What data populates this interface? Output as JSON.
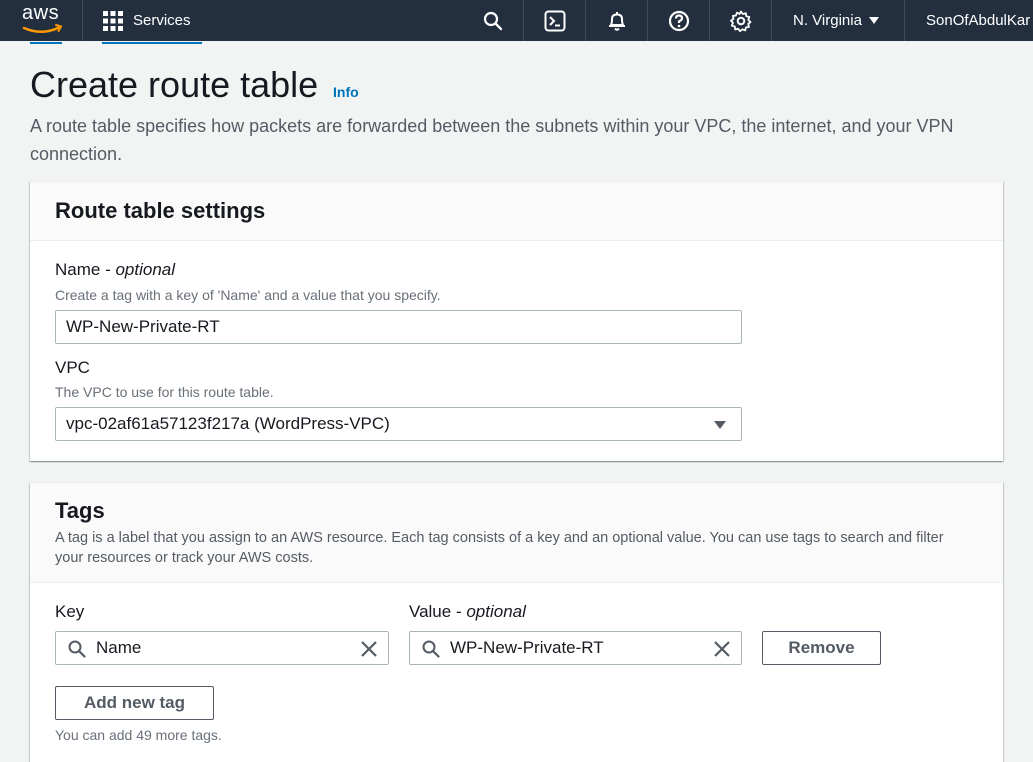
{
  "nav": {
    "logo": "aws",
    "services_label": "Services",
    "region": "N. Virginia",
    "account": "SonOfAbdulKar",
    "icons": [
      "grid-icon",
      "search-icon",
      "cloudshell-icon",
      "bell-icon",
      "help-icon",
      "gear-icon",
      "caret-down-icon"
    ]
  },
  "header": {
    "title": "Create route table",
    "info": "Info",
    "description": "A route table specifies how packets are forwarded between the subnets within your VPC, the internet, and your VPN connection."
  },
  "settings": {
    "title": "Route table settings",
    "name_label": "Name - ",
    "name_optional": "optional",
    "name_desc": "Create a tag with a key of 'Name' and a value that you specify.",
    "name_value": "WP-New-Private-RT",
    "vpc_label": "VPC",
    "vpc_desc": "The VPC to use for this route table.",
    "vpc_value": "vpc-02af61a57123f217a (WordPress-VPC)"
  },
  "tags": {
    "title": "Tags",
    "description": "A tag is a label that you assign to an AWS resource. Each tag consists of a key and an optional value. You can use tags to search and filter your resources or track your AWS costs.",
    "key_label": "Key",
    "value_label": "Value - ",
    "value_optional": "optional",
    "key_value": "Name",
    "value_value": "WP-New-Private-RT",
    "remove_label": "Remove",
    "add_label": "Add new tag",
    "limit_text": "You can add 49 more tags."
  },
  "colors": {
    "nav_bg": "#232f3e",
    "link": "#0073bb",
    "page_bg": "#f2f3f3"
  }
}
